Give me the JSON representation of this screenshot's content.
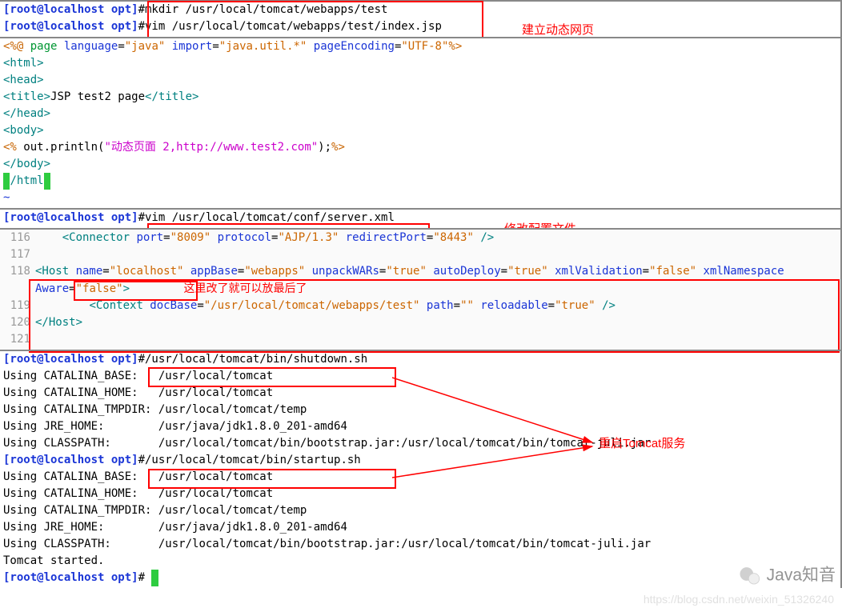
{
  "pane1": {
    "prompt": "[root@localhost opt]",
    "cmd1": "#mkdir /usr/local/tomcat/webapps/test",
    "cmd2": "#vim /usr/local/tomcat/webapps/test/index.jsp",
    "annot": "建立动态网页"
  },
  "jsp": {
    "l1a": "<%@ ",
    "l1b": "page ",
    "l1c": "language",
    "l1d": "=",
    "l1e": "\"java\"",
    "l1f": " import",
    "l1g": "=",
    "l1h": "\"java.util.*\"",
    "l1i": " pageEncoding",
    "l1j": "=",
    "l1k": "\"UTF-8\"",
    "l1l": "%>",
    "l2": "<html>",
    "l3": "<head>",
    "l4a": "<title>",
    "l4b": "JSP test2 page",
    "l4c": "</title>",
    "l5": "</head>",
    "l6": "<body>",
    "l7a": "<% ",
    "l7b": "out.println(",
    "l7c": "\"动态页面 2,http://www.test2.com\"",
    "l7d": ");",
    "l7e": "%>",
    "l8": "</body>",
    "l9pre": " ",
    "l9": "/html",
    "l9post": " ",
    "tilde": "~"
  },
  "pane3": {
    "prompt": "[root@localhost opt]",
    "cmd": "#vim /usr/local/tomcat/conf/server.xml",
    "annot": "修改配置文件"
  },
  "server": {
    "ln116": "116",
    "l116a": "<Connector ",
    "l116b": "port",
    "l116eq": "=",
    "l116c": "\"8009\"",
    "l116d": " protocol",
    "l116e": "\"AJP/1.3\"",
    "l116f": " redirectPort",
    "l116g": "\"8443\"",
    "l116h": " />",
    "ln117": "117",
    "ln118": "118",
    "l118a": "<Host ",
    "l118b": "name",
    "l118c": "\"localhost\"",
    "l118d": " appBase",
    "l118e": "\"webapps\"",
    "l118f": " unpackWARs",
    "l118g": "\"true\"",
    "l118h": " autoDeploy",
    "l118i": "\"true\"",
    "l118j": " xmlValidation",
    "l118k": "\"false\"",
    "l118l": " xmlNamespace",
    "l118m": "Aware",
    "l118n": "\"false\"",
    "l118o": ">",
    "annot_inline": "这里改了就可以放最后了",
    "ln119": "119",
    "l119a": "<Context ",
    "l119b": "docBase",
    "l119c": "\"/usr/local/tomcat/webapps/test\"",
    "l119d": " path",
    "l119e": "\"\"",
    "l119f": " reloadable",
    "l119g": "\"true\"",
    "l119h": " />",
    "ln120": "120",
    "l120": "</Host>",
    "ln121": "121"
  },
  "pane5": {
    "prompt": "[root@localhost opt]",
    "cmd_shutdown": "#/usr/local/tomcat/bin/shutdown.sh",
    "cmd_startup": "#/usr/local/tomcat/bin/startup.sh",
    "env1": {
      "CATALINA_BASE": "/usr/local/tomcat",
      "CATALINA_HOME": "/usr/local/tomcat",
      "CATALINA_TMPDIR": "/usr/local/tomcat/temp",
      "JRE_HOME": "/usr/java/jdk1.8.0_201-amd64",
      "CLASSPATH": "/usr/local/tomcat/bin/bootstrap.jar:/usr/local/tomcat/bin/tomcat-juli.jar"
    },
    "env2": {
      "CATALINA_BASE": "/usr/local/tomcat",
      "CATALINA_HOME": "/usr/local/tomcat",
      "CATALINA_TMPDIR": "/usr/local/tomcat/temp",
      "JRE_HOME": "/usr/java/jdk1.8.0_201-amd64",
      "CLASSPATH": "/usr/local/tomcat/bin/bootstrap.jar:/usr/local/tomcat/bin/tomcat-juli.jar"
    },
    "started": "Tomcat started.",
    "end_prompt": "# ",
    "annot": "重启Tomcat服务"
  },
  "wm": {
    "brand": "Java知音",
    "url": "https://blog.csdn.net/weixin_51326240"
  }
}
